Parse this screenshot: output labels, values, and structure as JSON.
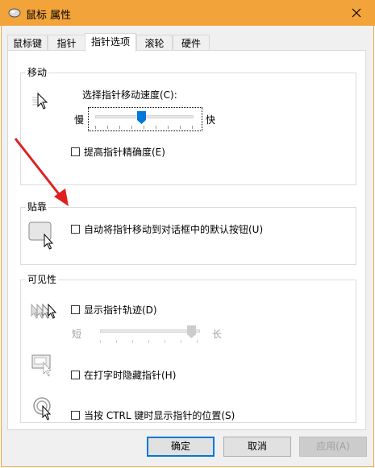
{
  "window": {
    "title": "鼠标 属性"
  },
  "tabs": [
    {
      "label": "鼠标键"
    },
    {
      "label": "指针"
    },
    {
      "label": "指针选项"
    },
    {
      "label": "滚轮"
    },
    {
      "label": "硬件"
    }
  ],
  "motion": {
    "title": "移动",
    "speed_label": "选择指针移动速度(C):",
    "slow": "慢",
    "fast": "快",
    "speed_value_fraction": 0.5,
    "precision_label": "提高指针精确度(E)",
    "precision_checked": false
  },
  "snap": {
    "title": "贴靠",
    "label": "自动将指针移动到对话框中的默认按钮(U)",
    "checked": false
  },
  "visibility": {
    "title": "可见性",
    "trails_label": "显示指针轨迹(D)",
    "trails_checked": false,
    "short": "短",
    "long": "长",
    "trails_value_fraction": 1.0,
    "hide_label": "在打字时隐藏指针(H)",
    "hide_checked": false,
    "ctrl_label": "当按 CTRL 键时显示指针的位置(S)",
    "ctrl_checked": false
  },
  "buttons": {
    "ok": "确定",
    "cancel": "取消",
    "apply": "应用(A)"
  },
  "colors": {
    "titlebar": "#f2a33a",
    "accent": "#0078d7",
    "annotation_arrow": "#e02020"
  }
}
